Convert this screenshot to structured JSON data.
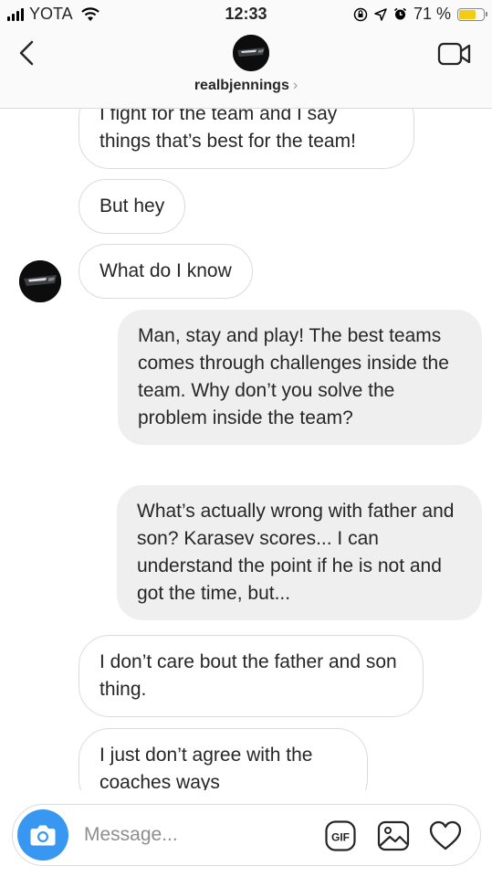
{
  "status_bar": {
    "carrier": "YOTA",
    "time": "12:33",
    "battery_percent": "71 %",
    "battery_level": 0.71,
    "battery_color": "#f5cc14"
  },
  "header": {
    "username": "realbjennings",
    "chevron": "›",
    "back_icon": "chevron-left-icon",
    "video_icon": "video-camera-icon"
  },
  "messages": [
    {
      "sender": "them",
      "text": "I fight for the team and I say things that’s best for the team!"
    },
    {
      "sender": "them",
      "text": "But hey"
    },
    {
      "sender": "them",
      "text": "What do I know"
    },
    {
      "sender": "me",
      "text": "Man, stay and play! The best teams comes through challenges inside the team. Why don’t you solve the problem inside the team?"
    },
    {
      "sender": "me",
      "text": "What’s actually wrong with father and son? Karasev scores... I can understand the point if he is not and got the time, but..."
    },
    {
      "sender": "them",
      "text": "I don’t care bout the father and son thing."
    },
    {
      "sender": "them",
      "text": "I just don’t agree with the coaches ways"
    }
  ],
  "composer": {
    "placeholder": "Message...",
    "gif_label": "GIF",
    "accent_color": "#3897f0"
  }
}
